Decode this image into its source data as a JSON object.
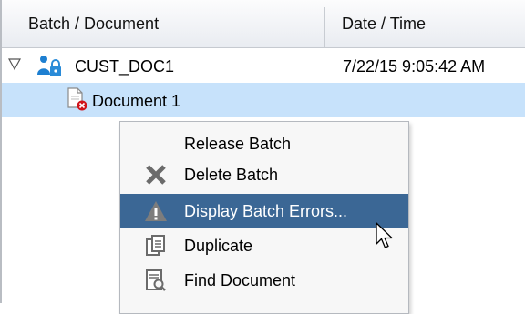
{
  "table": {
    "columns": [
      "Batch / Document",
      "Date / Time"
    ],
    "rows": [
      {
        "name": "CUST_DOC1",
        "date": "7/22/15 9:05:42 AM"
      },
      {
        "name": "Document 1"
      }
    ]
  },
  "context_menu": {
    "items": [
      {
        "label": "Release Batch",
        "icon": "none"
      },
      {
        "label": "Delete Batch",
        "icon": "x-icon"
      },
      {
        "label": "Display Batch Errors...",
        "icon": "warning-icon"
      },
      {
        "label": "Duplicate",
        "icon": "duplicate-icon"
      },
      {
        "label": "Find Document",
        "icon": "find-document-icon"
      }
    ]
  },
  "colors": {
    "selected_row": "#c7e2fb",
    "highlighted_menu_item": "#3b6795"
  }
}
